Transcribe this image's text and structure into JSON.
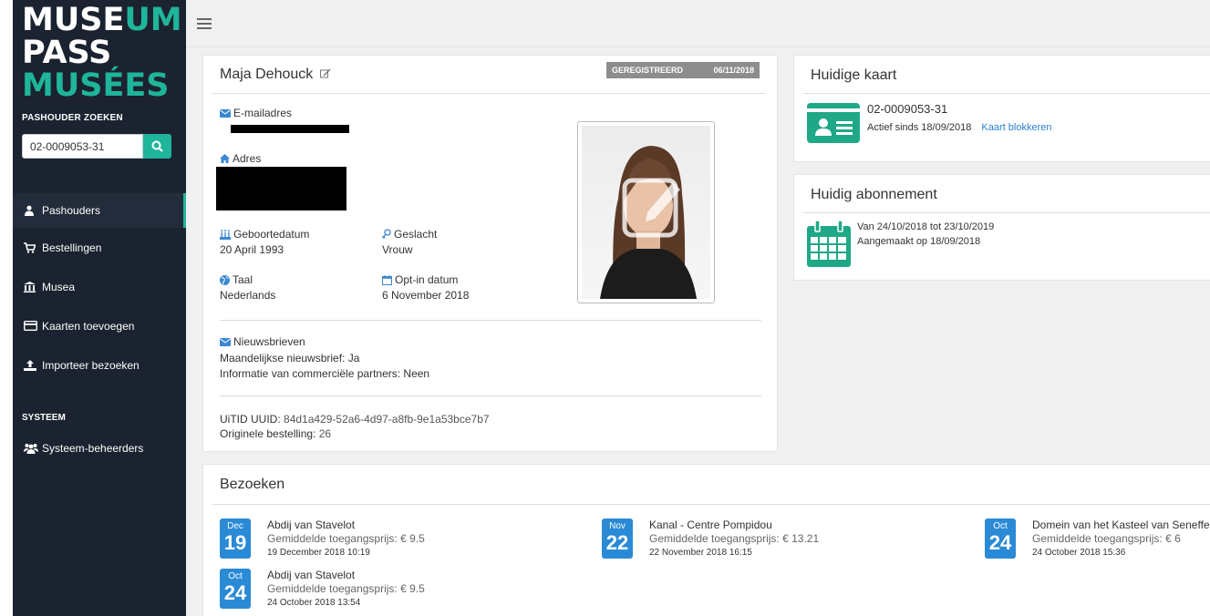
{
  "logo": {
    "line1a": "MUSE",
    "line1b": "UM",
    "line2": "PASS",
    "line3": "MUSÉES"
  },
  "sidebar": {
    "search_label": "PASHOUDER ZOEKEN",
    "search_value": "02-0009053-31",
    "items": [
      {
        "label": "Pashouders",
        "icon": "user-icon",
        "active": true
      },
      {
        "label": "Bestellingen",
        "icon": "cart-icon"
      },
      {
        "label": "Musea",
        "icon": "museum-icon"
      },
      {
        "label": "Kaarten toevoegen",
        "icon": "card-icon"
      },
      {
        "label": "Importeer bezoeken",
        "icon": "upload-icon"
      }
    ],
    "system_label": "SYSTEEM",
    "system_items": [
      {
        "label": "Systeem-beheerders",
        "icon": "users-icon"
      }
    ]
  },
  "profile": {
    "name": "Maja Dehouck",
    "status": "GEREGISTREERD",
    "status_date": "06/11/2018",
    "email_label": "E-mailadres",
    "address_label": "Adres",
    "birth_label": "Geboortedatum",
    "birth_value": "20 April 1993",
    "gender_label": "Geslacht",
    "gender_value": "Vrouw",
    "language_label": "Taal",
    "language_value": "Nederlands",
    "optin_label": "Opt-in datum",
    "optin_value": "6 November 2018",
    "newsletters_label": "Nieuwsbrieven",
    "newsletter_monthly": "Maandelijkse nieuwsbrief: Ja",
    "newsletter_partners": "Informatie van commerciële partners: Neen",
    "uuid_label": "UiTID UUID:",
    "uuid_value": "84d1a429-52a6-4d97-a8fb-9e1a53bce7b7",
    "order_label": "Originele bestelling:",
    "order_value": "26"
  },
  "card": {
    "title": "Huidige kaart",
    "number": "02-0009053-31",
    "active_since": "Actief sinds 18/09/2018",
    "block_link": "Kaart blokkeren"
  },
  "subscription": {
    "title": "Huidig abonnement",
    "period": "Van 24/10/2018 tot 23/10/2019",
    "created": "Aangemaakt op 18/09/2018"
  },
  "visits": {
    "title": "Bezoeken",
    "items": [
      {
        "month": "Dec",
        "day": "19",
        "museum": "Abdij van Stavelot",
        "price": "Gemiddelde toegangsprijs: € 9.5",
        "datetime": "19 December 2018 10:19"
      },
      {
        "month": "Nov",
        "day": "22",
        "museum": "Kanal - Centre Pompidou",
        "price": "Gemiddelde toegangsprijs: € 13.21",
        "datetime": "22 November 2018 16:15"
      },
      {
        "month": "Oct",
        "day": "24",
        "museum": "Domein van het Kasteel van Seneffe",
        "price": "Gemiddelde toegangsprijs: € 6",
        "datetime": "24 October 2018 15:36"
      },
      {
        "month": "Oct",
        "day": "24",
        "museum": "Abdij van Stavelot",
        "price": "Gemiddelde toegangsprijs: € 9.5",
        "datetime": "24 October 2018 13:54"
      }
    ]
  },
  "colors": {
    "brand": "#1fb59b",
    "sidebar": "#1b2330",
    "link": "#2a7fd0",
    "date_badge": "#2a8ad6"
  }
}
